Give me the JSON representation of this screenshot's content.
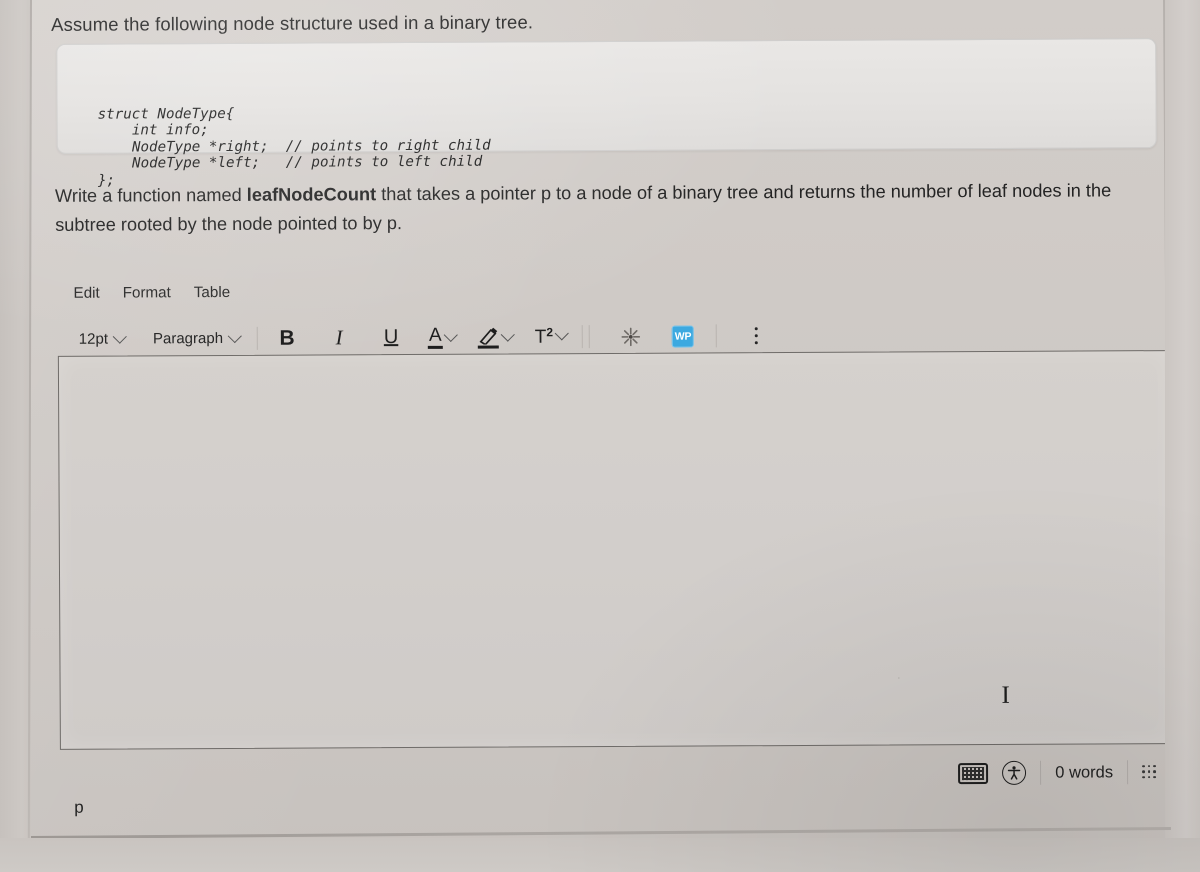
{
  "question": {
    "intro": "Assume the following node structure used in a binary tree.",
    "code": "struct NodeType{\n    int info;\n    NodeType *right;  // points to right child\n    NodeType *left;   // points to left child\n};",
    "prompt_pre": "Write a function named ",
    "prompt_bold": "leafNodeCount",
    "prompt_post": " that takes a pointer p to a node of a binary tree and returns the number of leaf nodes in the subtree rooted by the node pointed to by p."
  },
  "editor": {
    "menubar": [
      "Edit",
      "Format",
      "Table"
    ],
    "toolbar": {
      "fontsize": "12pt",
      "blockformat": "Paragraph",
      "bold": "B",
      "italic": "I",
      "underline": "U",
      "textcolor": "A",
      "superscript_t": "T",
      "superscript_n": "2",
      "special_char": "✳",
      "wp_badge": "WP"
    },
    "content": "",
    "caret_glyph": "I",
    "statusbar": {
      "element_path": "p",
      "word_count": "0 words"
    }
  },
  "colors": {
    "accent_badge": "#3da9e0",
    "editor_border": "#6f6c69",
    "text": "#232323"
  }
}
